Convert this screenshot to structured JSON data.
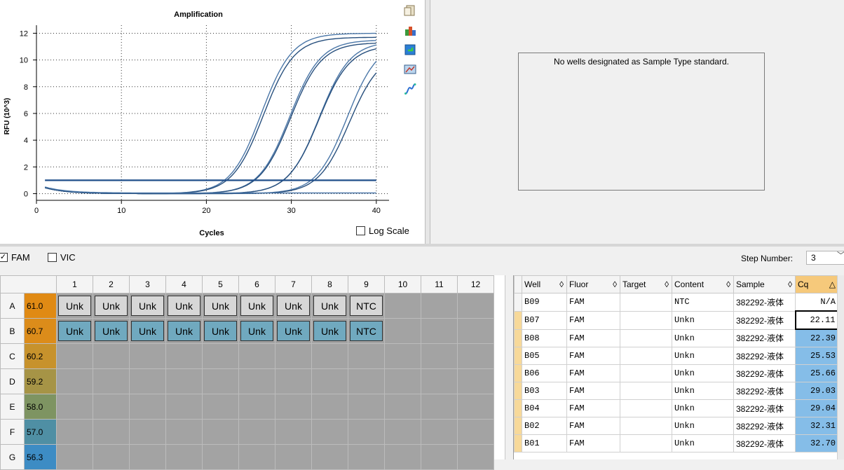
{
  "chart": {
    "title": "Amplification",
    "xlabel": "Cycles",
    "ylabel": "RFU (10^3)",
    "log_scale_label": "Log Scale",
    "log_scale_checked": false
  },
  "chart_data": {
    "type": "line",
    "title": "Amplification",
    "xlabel": "Cycles",
    "ylabel": "RFU (10^3)",
    "xlim": [
      0,
      41.5
    ],
    "ylim": [
      -0.5,
      12.6
    ],
    "xticks": [
      0,
      10,
      20,
      30,
      40
    ],
    "yticks": [
      0,
      2,
      4,
      6,
      8,
      10,
      12
    ],
    "grid": true,
    "threshold": 1.0,
    "series": [
      {
        "well": "B07",
        "cq": 22.11,
        "plateau": 12.0
      },
      {
        "well": "B08",
        "cq": 22.39,
        "plateau": 11.7
      },
      {
        "well": "B05",
        "cq": 25.53,
        "plateau": 11.5
      },
      {
        "well": "B06",
        "cq": 25.66,
        "plateau": 11.3
      },
      {
        "well": "B03",
        "cq": 29.03,
        "plateau": 11.4
      },
      {
        "well": "B04",
        "cq": 29.04,
        "plateau": 11.1
      },
      {
        "well": "B02",
        "cq": 32.31,
        "plateau": 11.4
      },
      {
        "well": "B01",
        "cq": 32.7,
        "plateau": 10.6
      },
      {
        "well": "B09",
        "cq": null,
        "plateau": 0
      }
    ]
  },
  "standard_curve": {
    "message": "No wells designated as Sample Type standard."
  },
  "fluors": [
    {
      "label": "FAM",
      "checked": true
    },
    {
      "label": "VIC",
      "checked": false
    }
  ],
  "step": {
    "label": "Step Number:",
    "value": "3"
  },
  "plate": {
    "columns": [
      "1",
      "2",
      "3",
      "4",
      "5",
      "6",
      "7",
      "8",
      "9",
      "10",
      "11",
      "12"
    ],
    "rows": [
      {
        "label": "A",
        "temp": "61.0",
        "temp_color": "#e08a14",
        "wells": [
          "Unk",
          "Unk",
          "Unk",
          "Unk",
          "Unk",
          "Unk",
          "Unk",
          "Unk",
          "NTC"
        ],
        "style": "A"
      },
      {
        "label": "B",
        "temp": "60.7",
        "temp_color": "#dc8c1a",
        "wells": [
          "Unk",
          "Unk",
          "Unk",
          "Unk",
          "Unk",
          "Unk",
          "Unk",
          "Unk",
          "NTC"
        ],
        "style": "B"
      },
      {
        "label": "C",
        "temp": "60.2",
        "temp_color": "#c7922c",
        "wells": [],
        "style": ""
      },
      {
        "label": "D",
        "temp": "59.2",
        "temp_color": "#a69446",
        "wells": [],
        "style": ""
      },
      {
        "label": "E",
        "temp": "58.0",
        "temp_color": "#7e9462",
        "wells": [],
        "style": ""
      },
      {
        "label": "F",
        "temp": "57.0",
        "temp_color": "#4f8fa4",
        "wells": [],
        "style": ""
      },
      {
        "label": "G",
        "temp": "56.3",
        "temp_color": "#3d8cc4",
        "wells": [],
        "style": ""
      }
    ]
  },
  "results": {
    "headers": [
      {
        "label": "Well",
        "sort": "◊"
      },
      {
        "label": "Fluor",
        "sort": "◊"
      },
      {
        "label": "Target",
        "sort": "◊"
      },
      {
        "label": "Content",
        "sort": "◊"
      },
      {
        "label": "Sample",
        "sort": "◊"
      },
      {
        "label": "Cq",
        "sort": "△"
      }
    ],
    "rows": [
      {
        "well": "B09",
        "fluor": "FAM",
        "target": "",
        "content": "NTC",
        "sample": "382292-液体",
        "cq": "N/A"
      },
      {
        "well": "B07",
        "fluor": "FAM",
        "target": "",
        "content": "Unkn",
        "sample": "382292-液体",
        "cq": "22.11"
      },
      {
        "well": "B08",
        "fluor": "FAM",
        "target": "",
        "content": "Unkn",
        "sample": "382292-液体",
        "cq": "22.39"
      },
      {
        "well": "B05",
        "fluor": "FAM",
        "target": "",
        "content": "Unkn",
        "sample": "382292-液体",
        "cq": "25.53"
      },
      {
        "well": "B06",
        "fluor": "FAM",
        "target": "",
        "content": "Unkn",
        "sample": "382292-液体",
        "cq": "25.66"
      },
      {
        "well": "B03",
        "fluor": "FAM",
        "target": "",
        "content": "Unkn",
        "sample": "382292-液体",
        "cq": "29.03"
      },
      {
        "well": "B04",
        "fluor": "FAM",
        "target": "",
        "content": "Unkn",
        "sample": "382292-液体",
        "cq": "29.04"
      },
      {
        "well": "B02",
        "fluor": "FAM",
        "target": "",
        "content": "Unkn",
        "sample": "382292-液体",
        "cq": "32.31"
      },
      {
        "well": "B01",
        "fluor": "FAM",
        "target": "",
        "content": "Unkn",
        "sample": "382292-液体",
        "cq": "32.70"
      }
    ]
  },
  "toolbar": {
    "icons": [
      "copy-icon",
      "export-icon",
      "refresh-icon",
      "settings-icon",
      "curve-icon"
    ]
  }
}
